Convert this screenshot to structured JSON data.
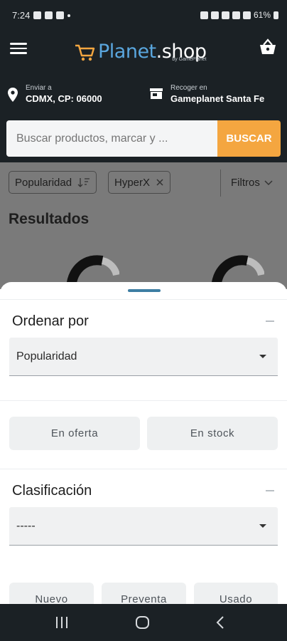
{
  "status_bar": {
    "time": "7:24",
    "battery": "61%"
  },
  "header": {
    "brand_part1": "Planet",
    "brand_part2": ".shop",
    "byline": "by GamePlanet"
  },
  "delivery": {
    "ship_label": "Enviar a",
    "ship_value": "CDMX, CP: 06000",
    "pickup_label": "Recoger en",
    "pickup_value": "Gameplanet Santa Fe"
  },
  "search": {
    "placeholder": "Buscar productos, marcar y ...",
    "button_label": "BUSCAR"
  },
  "filters": {
    "sort_chip": "Popularidad",
    "brand_chip": "HyperX",
    "filters_label": "Filtros"
  },
  "results": {
    "title": "Resultados"
  },
  "sheet": {
    "sort_title": "Ordenar por",
    "sort_value": "Popularidad",
    "toggle_offer": "En oferta",
    "toggle_stock": "En stock",
    "class_title": "Clasificación",
    "class_value": "-----",
    "cond_new": "Nuevo",
    "cond_presale": "Preventa",
    "cond_used": "Usado"
  },
  "colors": {
    "header_bg": "#1b2125",
    "accent_orange": "#f4a640",
    "brand_blue": "#5aa6de",
    "handle_blue": "#3e7ea3"
  },
  "icons": [
    "menu-icon",
    "cart-logo-icon",
    "basket-icon",
    "location-pin-icon",
    "store-icon",
    "sort-icon",
    "close-icon",
    "chevron-down-icon",
    "caret-down-icon",
    "recent-apps-icon",
    "home-icon",
    "back-icon"
  ]
}
